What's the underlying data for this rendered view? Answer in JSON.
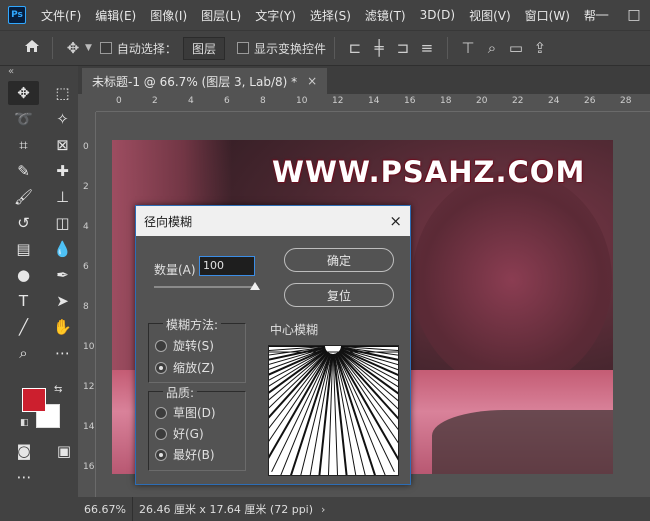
{
  "app": {
    "logo": "Ps"
  },
  "menu": [
    "文件(F)",
    "编辑(E)",
    "图像(I)",
    "图层(L)",
    "文字(Y)",
    "选择(S)",
    "滤镜(T)",
    "3D(D)",
    "视图(V)",
    "窗口(W)",
    "帮"
  ],
  "window_controls": {
    "minimize": "—",
    "maximize": "□"
  },
  "options_bar": {
    "auto_select_label": "自动选择：",
    "auto_select_target": "图层",
    "show_transform_label": "显示变换控件"
  },
  "document": {
    "tab_title": "未标题-1 @ 66.7% (图层 3, Lab/8) *",
    "close": "×"
  },
  "ruler": {
    "h_labels": [
      "0",
      "2",
      "4",
      "6",
      "8",
      "10",
      "12",
      "14",
      "16",
      "18",
      "20",
      "22",
      "24",
      "26",
      "28"
    ],
    "v_labels": [
      "0",
      "2",
      "4",
      "6",
      "8",
      "10",
      "12",
      "14",
      "16"
    ]
  },
  "canvas": {
    "watermark": "WWW.PSAHZ.COM"
  },
  "colors": {
    "foreground": "#cc1f2e",
    "background": "#ffffff"
  },
  "status": {
    "zoom": "66.67%",
    "info": "26.46 厘米 x 17.64 厘米 (72 ppi)",
    "arrow": "›"
  },
  "dialog": {
    "title": "径向模糊",
    "close": "×",
    "amount_label": "数量(A)",
    "amount_value": "100",
    "ok": "确定",
    "reset": "复位",
    "method_title": "模糊方法:",
    "method_options": [
      {
        "label": "旋转(S)",
        "selected": false
      },
      {
        "label": "缩放(Z)",
        "selected": true
      }
    ],
    "quality_title": "品质:",
    "quality_options": [
      {
        "label": "草图(D)",
        "selected": false
      },
      {
        "label": "好(G)",
        "selected": false
      },
      {
        "label": "最好(B)",
        "selected": true
      }
    ],
    "center_label": "中心模糊",
    "slider_value": 100
  }
}
